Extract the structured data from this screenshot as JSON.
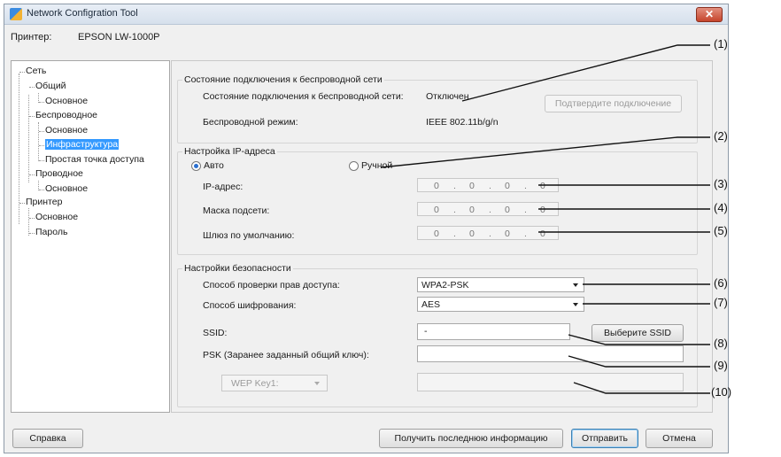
{
  "window": {
    "title": "Network Configration Tool",
    "close": "✕"
  },
  "printer": {
    "label": "Принтер:",
    "value": "EPSON LW-1000P"
  },
  "tree": {
    "network": "Сеть",
    "general": "Общий",
    "general_basic": "Основное",
    "wireless": "Беспроводное",
    "wireless_basic": "Основное",
    "infrastructure": "Инфраструктура",
    "simple_ap": "Простая точка доступа",
    "wired": "Проводное",
    "wired_basic": "Основное",
    "printer": "Принтер",
    "printer_basic": "Основное",
    "password": "Пароль"
  },
  "conn": {
    "group_title": "Состояние подключения к беспроводной сети",
    "status_label": "Состояние подключения к беспроводной сети:",
    "status_value": "Отключен",
    "confirm_button": "Подтвердите подключение",
    "mode_label": "Беспроводной режим:",
    "mode_value": "IEEE 802.11b/g/n"
  },
  "ip": {
    "group_title": "Настройка IP-адреса",
    "auto": "Авто",
    "manual": "Ручной",
    "selected": "auto",
    "address_label": "IP-адрес:",
    "mask_label": "Маска подсети:",
    "gateway_label": "Шлюз по умолчанию:",
    "octet": "0",
    "dot": "."
  },
  "security": {
    "group_title": "Настройки безопасности",
    "auth_label": "Способ проверки прав доступа:",
    "auth_value": "WPA2-PSK",
    "enc_label": "Способ шифрования:",
    "enc_value": "AES",
    "ssid_label": "SSID:",
    "ssid_value": "-",
    "ssid_button": "Выберите SSID",
    "psk_label": "PSK (Заранее заданный общий ключ):",
    "psk_value": "",
    "wep_select": "WEP Key1:",
    "wep_value": ""
  },
  "footer": {
    "help": "Справка",
    "refresh": "Получить последнюю информацию",
    "send": "Отправить",
    "cancel": "Отмена"
  },
  "callouts": [
    "(1)",
    "(2)",
    "(3)",
    "(4)",
    "(5)",
    "(6)",
    "(7)",
    "(8)",
    "(9)",
    "(10)"
  ]
}
